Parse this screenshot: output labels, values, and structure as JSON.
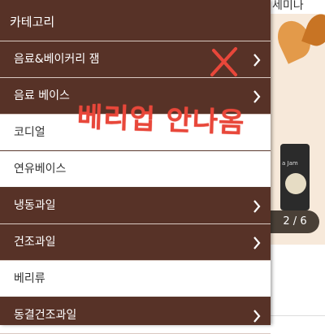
{
  "background": {
    "top_text": "세미나",
    "slide_counter": "2 / 6",
    "product_label": "a Jam"
  },
  "drawer": {
    "title": "카테고리",
    "items": [
      {
        "label": "음료&베이커리 잼",
        "has_chevron": true,
        "style": "dark"
      },
      {
        "label": "음료 베이스",
        "has_chevron": true,
        "style": "dark"
      },
      {
        "label": "코디얼",
        "has_chevron": false,
        "style": "light"
      },
      {
        "label": "연유베이스",
        "has_chevron": false,
        "style": "light"
      },
      {
        "label": "냉동과일",
        "has_chevron": true,
        "style": "dark"
      },
      {
        "label": "건조과일",
        "has_chevron": true,
        "style": "dark"
      },
      {
        "label": "베리류",
        "has_chevron": false,
        "style": "light"
      },
      {
        "label": "동결건조과일",
        "has_chevron": true,
        "style": "dark"
      }
    ]
  },
  "annotation": {
    "text": "베리업 안나옴",
    "color": "#e8473a"
  },
  "colors": {
    "drawer_bg": "#573227",
    "light_row_bg": "#ffffff",
    "divider": "#d9c9c1"
  }
}
